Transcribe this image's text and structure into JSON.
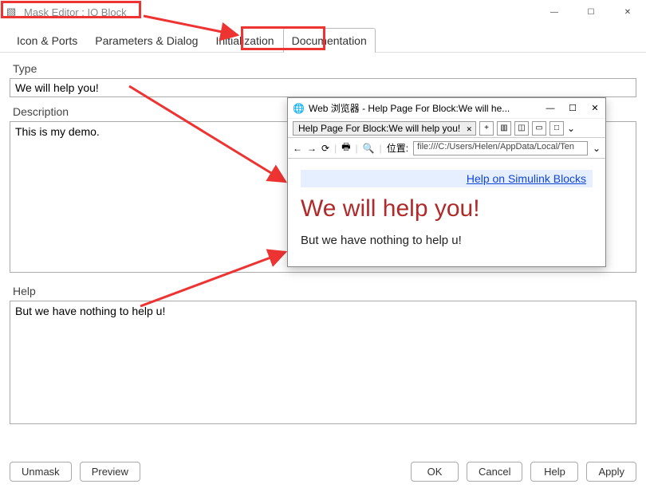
{
  "window": {
    "title": "Mask Editor : IO Block"
  },
  "tabs": {
    "icon_ports": "Icon & Ports",
    "params_dialog": "Parameters & Dialog",
    "initialization": "Initialization",
    "documentation": "Documentation"
  },
  "groups": {
    "type_label": "Type",
    "type_value": "We will help you!",
    "desc_label": "Description",
    "desc_value": "This is my demo.",
    "help_label": "Help",
    "help_value": "But we have nothing to help u!"
  },
  "buttons": {
    "unmask": "Unmask",
    "preview": "Preview",
    "ok": "OK",
    "cancel": "Cancel",
    "help": "Help",
    "apply": "Apply"
  },
  "popup": {
    "title": "Web 浏览器 - Help Page For Block:We will he...",
    "tab_label": "Help Page For Block:We will help you!",
    "plus": "+",
    "url_label": "位置:",
    "url_value": "file:///C:/Users/Helen/AppData/Local/Ten",
    "link": "Help on Simulink Blocks",
    "heading": "We will help you!",
    "body": "But we have nothing to help u!"
  },
  "icons": {
    "min": "—",
    "max": "☐",
    "close": "✕",
    "chevron": "⌄",
    "back": "←",
    "fwd": "→",
    "reload": "⟳",
    "print": "🖶",
    "zoom": "🔍",
    "home": "⌂"
  }
}
